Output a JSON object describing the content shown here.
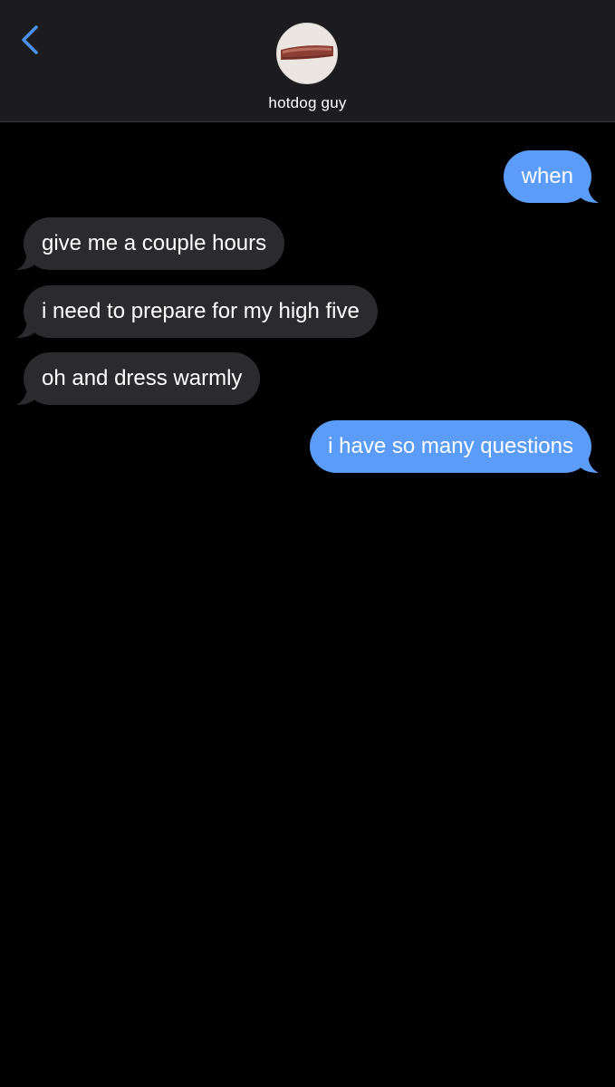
{
  "header": {
    "contact_name": "hotdog guy"
  },
  "colors": {
    "sent_bubble": "#5a9cf8",
    "received_bubble": "#2b2b2d",
    "accent": "#4a90e2",
    "background": "#000000",
    "header_background": "#1c1c1e"
  },
  "icons": {
    "back": "chevron-left-icon",
    "avatar": "hotdog-photo"
  },
  "messages": [
    {
      "direction": "sent",
      "text": "when"
    },
    {
      "direction": "received",
      "text": "give me a couple hours"
    },
    {
      "direction": "received",
      "text": "i need to prepare for my high five"
    },
    {
      "direction": "received",
      "text": "oh and dress warmly"
    },
    {
      "direction": "sent",
      "text": "i have so many questions"
    }
  ]
}
